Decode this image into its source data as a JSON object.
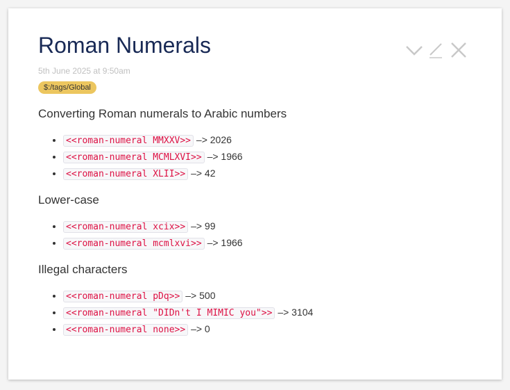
{
  "tiddler": {
    "title": "Roman Numerals",
    "subtitle": "5th June 2025 at 9:50am",
    "tag": "$:/tags/Global",
    "sections": [
      {
        "heading": "Converting Roman numerals to Arabic numbers",
        "items": [
          {
            "code": "<<roman-numeral MMXXV>>",
            "result": "–> 2026"
          },
          {
            "code": "<<roman-numeral MCMLXVI>>",
            "result": "–> 1966"
          },
          {
            "code": "<<roman-numeral XLII>>",
            "result": "–> 42"
          }
        ]
      },
      {
        "heading": "Lower-case",
        "items": [
          {
            "code": "<<roman-numeral xcix>>",
            "result": "–> 99"
          },
          {
            "code": "<<roman-numeral mcmlxvi>>",
            "result": "–> 1966"
          }
        ]
      },
      {
        "heading": "Illegal characters",
        "items": [
          {
            "code": "<<roman-numeral pDq>>",
            "result": "–> 500"
          },
          {
            "code": "<<roman-numeral \"DIDn't I MIMIC you\">>",
            "result": "–> 3104"
          },
          {
            "code": "<<roman-numeral none>>",
            "result": "–> 0"
          }
        ]
      }
    ]
  },
  "icons": {
    "fold": "chevron-down-icon",
    "edit": "pencil-icon",
    "close": "close-icon"
  },
  "colors": {
    "title": "#182955",
    "tag_background": "#ecc65f",
    "code_text": "#dd1144",
    "icon": "#c8c8c8"
  }
}
